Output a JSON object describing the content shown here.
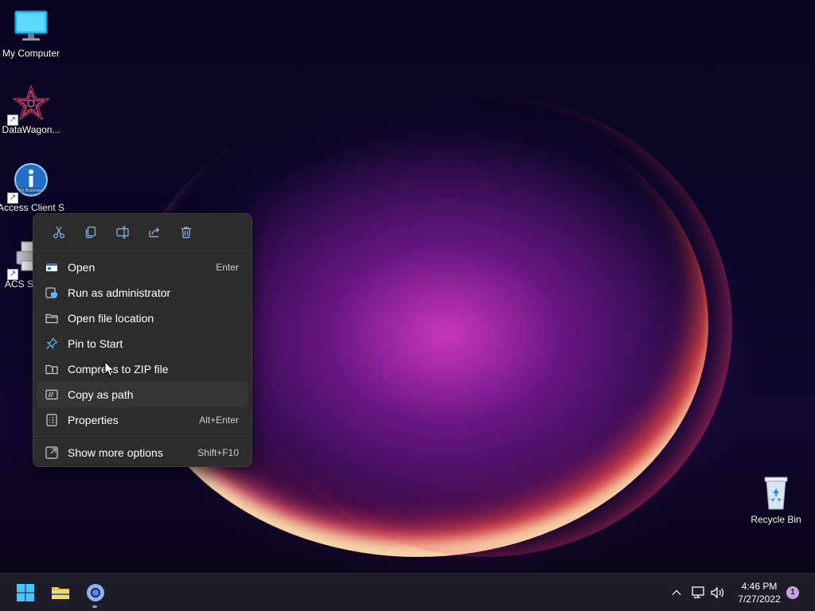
{
  "desktop": {
    "icons": [
      {
        "label": "My Computer",
        "icon": "monitor-icon"
      },
      {
        "label": "DataWagon...",
        "icon": "datawagon-app-icon",
        "shortcut": true
      },
      {
        "label": "Access Client Solut",
        "icon": "info-circle-icon",
        "badge_text": "for Business",
        "shortcut": true
      },
      {
        "label": "ACS Se... M",
        "icon": "printer-icon",
        "shortcut": true
      },
      {
        "label": "Recycle Bin",
        "icon": "recycle-bin-icon"
      }
    ]
  },
  "context_menu": {
    "quick_actions": [
      {
        "name": "cut",
        "icon": "scissors-icon"
      },
      {
        "name": "copy",
        "icon": "copy-icon"
      },
      {
        "name": "rename",
        "icon": "rename-icon"
      },
      {
        "name": "share",
        "icon": "share-icon"
      },
      {
        "name": "delete",
        "icon": "trash-icon"
      }
    ],
    "items": [
      {
        "label": "Open",
        "accel": "Enter",
        "icon": "open-window-icon"
      },
      {
        "label": "Run as administrator",
        "accel": "",
        "icon": "shield-admin-icon"
      },
      {
        "label": "Open file location",
        "accel": "",
        "icon": "folder-icon"
      },
      {
        "label": "Pin to Start",
        "accel": "",
        "icon": "pin-icon"
      },
      {
        "label": "Compress to ZIP file",
        "accel": "",
        "icon": "zip-folder-icon"
      },
      {
        "label": "Copy as path",
        "accel": "",
        "icon": "copy-path-icon",
        "hovered": true
      },
      {
        "label": "Properties",
        "accel": "Alt+Enter",
        "icon": "properties-icon"
      }
    ],
    "more": {
      "label": "Show more options",
      "accel": "Shift+F10",
      "icon": "show-more-icon"
    }
  },
  "taskbar": {
    "apps": [
      {
        "name": "start",
        "icon": "windows-logo-icon"
      },
      {
        "name": "file-explorer",
        "icon": "folder-icon"
      },
      {
        "name": "chrome",
        "icon": "chrome-icon",
        "running": true
      }
    ],
    "tray": {
      "icons": [
        "chevron-up-icon",
        "network-icon",
        "volume-icon"
      ],
      "time": "4:46 PM",
      "date": "7/27/2022",
      "notification_count": "1"
    }
  },
  "colors": {
    "menu_bg": "#2c2c2c",
    "menu_hover": "#353535",
    "taskbar_bg": "#1d1d27",
    "accent_blue": "#4cc2ff"
  }
}
